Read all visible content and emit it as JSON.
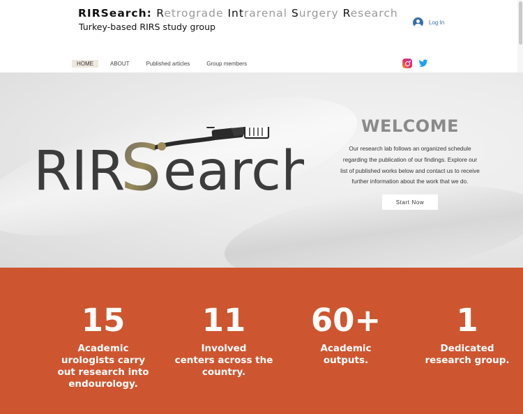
{
  "header": {
    "title_parts": [
      {
        "text": "RIRSearch: ",
        "style": "bold"
      },
      {
        "text": "R",
        "style": "dark"
      },
      {
        "text": "etrograde ",
        "style": "light"
      },
      {
        "text": "I",
        "style": "dark"
      },
      {
        "text": "nt",
        "style": "dark"
      },
      {
        "text": "rarenal ",
        "style": "light"
      },
      {
        "text": "S",
        "style": "dark"
      },
      {
        "text": "urgery ",
        "style": "light"
      },
      {
        "text": "R",
        "style": "dark"
      },
      {
        "text": "esearch",
        "style": "dark"
      }
    ],
    "subtitle": "Turkey-based RIRS study group",
    "login_label": "Log In",
    "login_icon": "user-avatar-icon"
  },
  "nav": {
    "items": [
      {
        "label": "HOME",
        "active": true
      },
      {
        "label": "ABOUT",
        "active": false
      },
      {
        "label": "Published articles",
        "active": false
      },
      {
        "label": "Group members",
        "active": false
      }
    ]
  },
  "social": {
    "icons": [
      "instagram-icon",
      "twitter-icon"
    ]
  },
  "hero": {
    "logo_text_left": "RIR",
    "logo_text_s": "S",
    "logo_text_right": "earch",
    "welcome_title": "WELCOME",
    "welcome_lines": [
      "Our research lab follows an organized schedule",
      "regarding the publication of our findings. Explore our",
      "list of published works below and contact us to receive",
      "further information about the work that we do."
    ],
    "cta_label": "Start Now"
  },
  "stats": [
    {
      "number": "15",
      "label_lines": [
        "Academic",
        "urologists carry",
        "out research into",
        "endourology."
      ]
    },
    {
      "number": "11",
      "label_lines": [
        "Involved",
        "centers across the",
        "country."
      ]
    },
    {
      "number": "60+",
      "label_lines": [
        "Academic",
        "outputs."
      ]
    },
    {
      "number": "1",
      "label_lines": [
        "Dedicated",
        "research group."
      ]
    }
  ],
  "colors": {
    "accent": "#cd5630",
    "login_blue": "#3a6ea5",
    "welcome_gray": "#8a8a8a"
  }
}
